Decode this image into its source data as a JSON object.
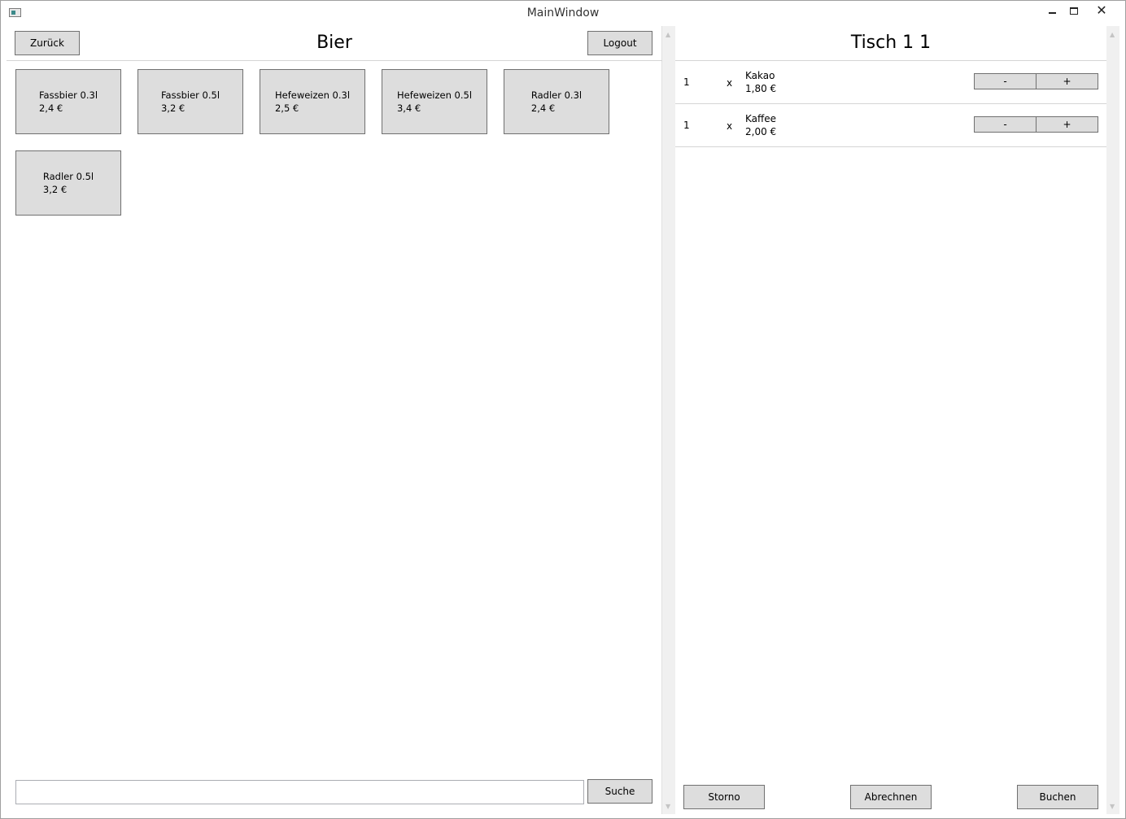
{
  "window": {
    "title": "MainWindow",
    "close_glyph": "✕"
  },
  "left": {
    "back_label": "Zurück",
    "category_title": "Bier",
    "logout_label": "Logout",
    "products": [
      {
        "name": "Fassbier 0.3l",
        "price": "2,4 €"
      },
      {
        "name": "Fassbier 0.5l",
        "price": "3,2 €"
      },
      {
        "name": "Hefeweizen 0.3l",
        "price": "2,5 €"
      },
      {
        "name": "Hefeweizen 0.5l",
        "price": "3,4 €"
      },
      {
        "name": "Radler 0.3l",
        "price": "2,4 €"
      },
      {
        "name": "Radler 0.5l",
        "price": "3,2 €"
      }
    ],
    "search": {
      "value": "",
      "placeholder": ""
    },
    "search_label": "Suche"
  },
  "right": {
    "table_title": "Tisch 1 1",
    "orders": [
      {
        "qty": "1",
        "x": "x",
        "name": "Kakao",
        "price": "1,80 €",
        "minus": "-",
        "plus": "+"
      },
      {
        "qty": "1",
        "x": "x",
        "name": "Kaffee",
        "price": "2,00 €",
        "minus": "-",
        "plus": "+"
      }
    ],
    "storno_label": "Storno",
    "abrechnen_label": "Abrechnen",
    "buchen_label": "Buchen"
  },
  "scroll": {
    "up_glyph": "▲",
    "down_glyph": "▼"
  }
}
